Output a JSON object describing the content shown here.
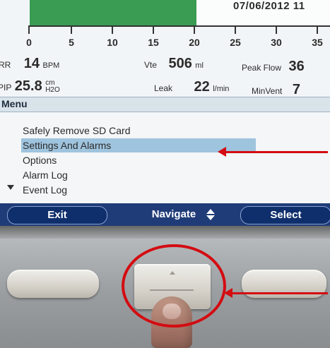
{
  "header": {
    "date": "07/06/2012 11"
  },
  "scale": {
    "ticks": [
      "0",
      "5",
      "10",
      "15",
      "20",
      "25",
      "30",
      "35"
    ]
  },
  "readouts": {
    "rr": {
      "label": "RR",
      "value": "14",
      "unit": "BPM"
    },
    "pip": {
      "label": "PIP",
      "value": "25.8",
      "unit_top": "cm",
      "unit_bottom": "H2O"
    },
    "vte": {
      "label": "Vte",
      "value": "506",
      "unit": "ml"
    },
    "peak_flow": {
      "label": "Peak Flow",
      "value": "36"
    },
    "leak": {
      "label": "Leak",
      "value": "22",
      "unit": "l/min"
    },
    "min_vent": {
      "label": "MinVent",
      "value": "7"
    }
  },
  "menu": {
    "title": "Menu",
    "items": [
      {
        "label": "Safely Remove SD Card",
        "selected": false
      },
      {
        "label": "Settings And Alarms",
        "selected": true
      },
      {
        "label": "Options",
        "selected": false
      },
      {
        "label": "Alarm Log",
        "selected": false
      },
      {
        "label": "Event Log",
        "selected": false
      }
    ]
  },
  "softkeys": {
    "left": "Exit",
    "middle": "Navigate",
    "right": "Select"
  },
  "colors": {
    "accent_red": "#d30c12",
    "progress_green": "#3a9b52",
    "softkey_blue": "#1f3c78",
    "selection_blue": "#9fc4de"
  },
  "icons": {
    "navigate": "up-down-arrows-icon",
    "scroll": "scroll-down-caret-icon"
  }
}
